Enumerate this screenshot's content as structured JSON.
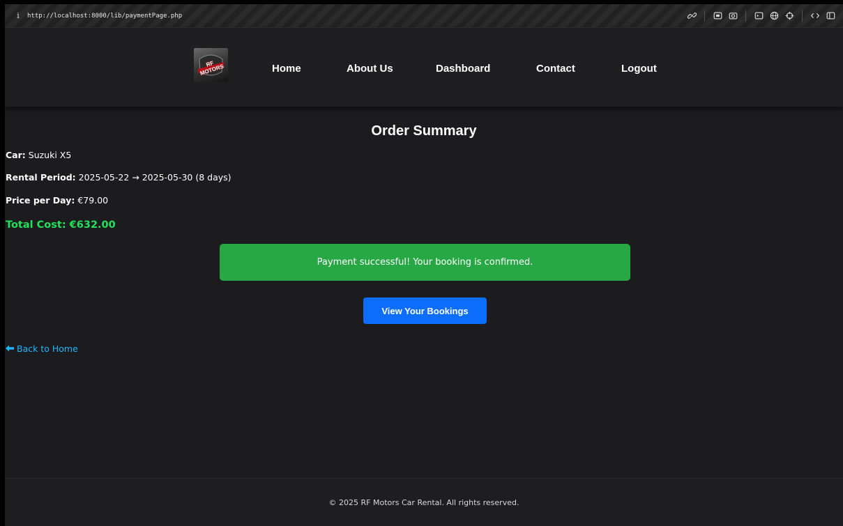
{
  "browser": {
    "url": "http://localhost:8000/lib/paymentPage.php",
    "icons": [
      "info-icon",
      "link-icon",
      "screenshot-icon",
      "camera-icon",
      "terminal-icon",
      "globe-icon",
      "crosshair-icon",
      "code-icon",
      "sidebar-icon"
    ]
  },
  "header": {
    "logo_text": "RF MOTORS",
    "nav": [
      {
        "label": "Home"
      },
      {
        "label": "About Us"
      },
      {
        "label": "Dashboard"
      },
      {
        "label": "Contact"
      },
      {
        "label": "Logout"
      }
    ]
  },
  "order": {
    "title": "Order Summary",
    "car_label": "Car:",
    "car_value": "Suzuki X5",
    "period_label": "Rental Period:",
    "period_value": "2025-05-22 → 2025-05-30 (8 days)",
    "price_label": "Price per Day:",
    "price_value": "€79.00",
    "total": "Total Cost: €632.00"
  },
  "banner": {
    "message": "Payment successful! Your booking is confirmed."
  },
  "actions": {
    "view_bookings": "View Your Bookings",
    "back_home": "Back to Home"
  },
  "footer": {
    "text": "© 2025 RF Motors Car Rental. All rights reserved."
  },
  "colors": {
    "background": "#1c1c1e",
    "success": "#28a745",
    "total": "#22e05a",
    "primary_button": "#0d6efd",
    "link": "#1fb6ff"
  }
}
